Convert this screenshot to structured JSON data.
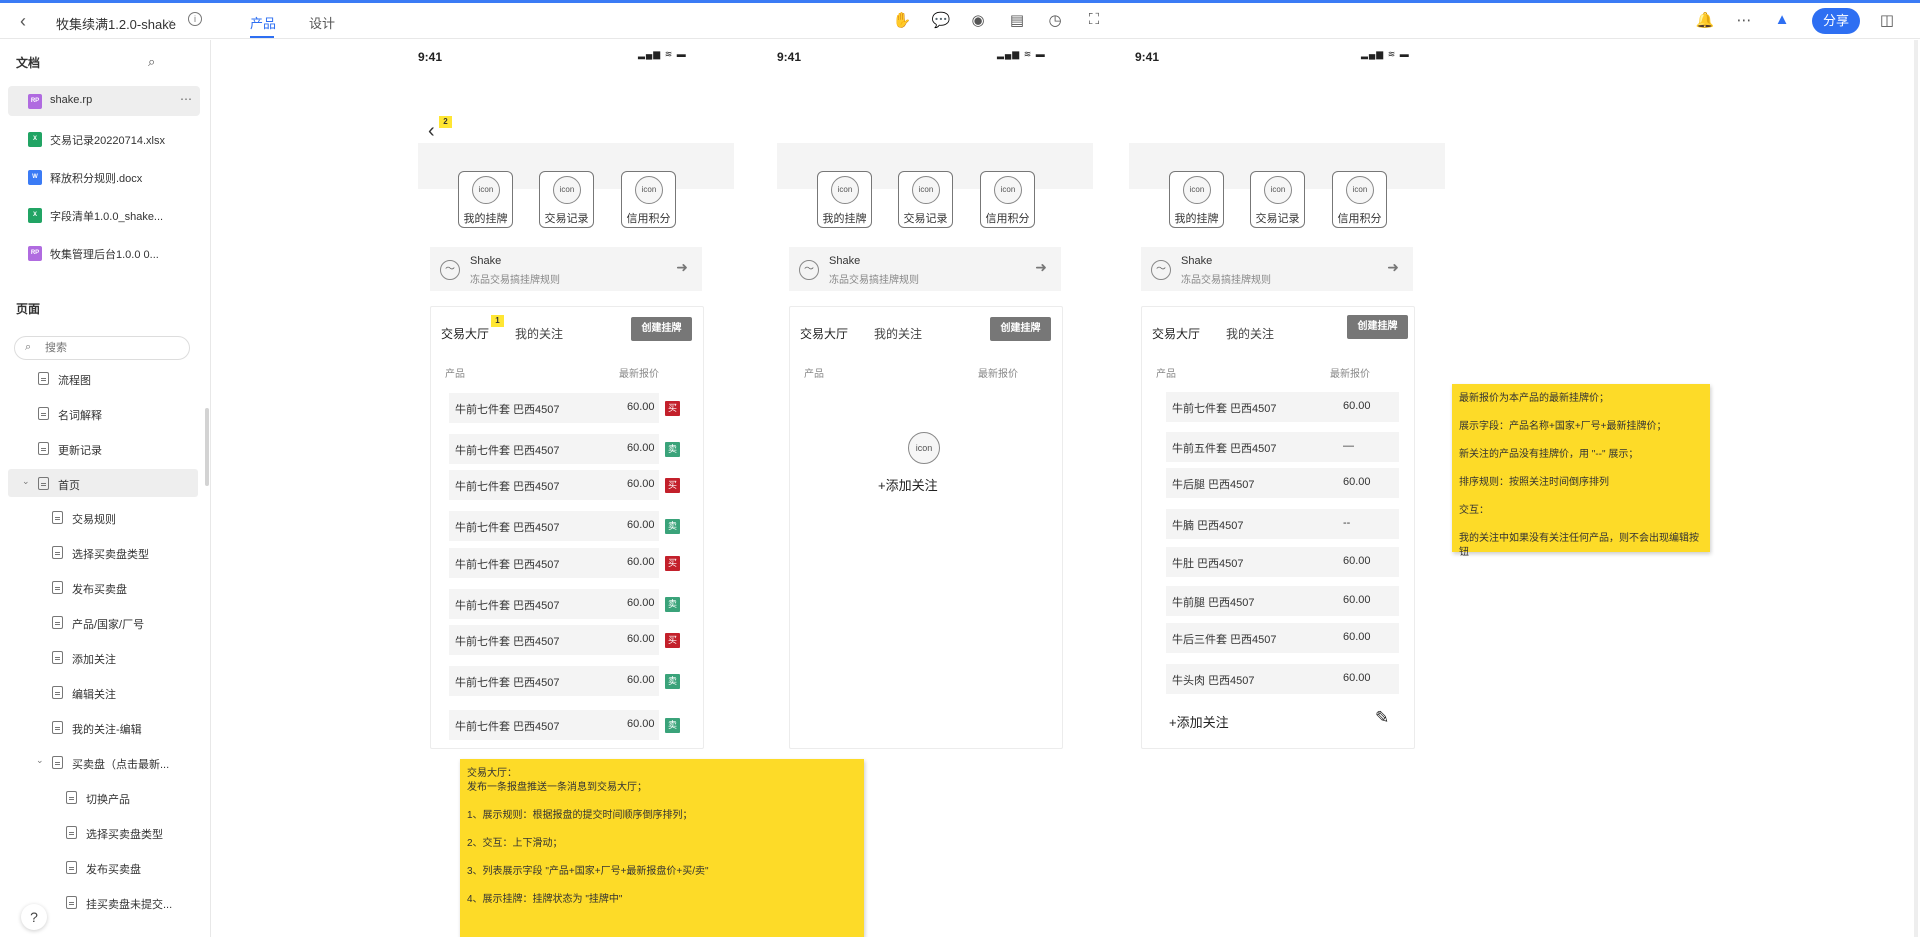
{
  "topbar": {
    "project": "牧集续满1.2.0-shake",
    "info_icon": "i",
    "tabs": [
      "产品",
      "设计"
    ],
    "share": "分享"
  },
  "sidebar": {
    "docs_title": "文档",
    "docs": [
      {
        "label": "shake.rp",
        "type": "RP",
        "color": "#b06be0"
      },
      {
        "label": "交易记录20220714.xlsx",
        "type": "X",
        "color": "#21a464"
      },
      {
        "label": "释放积分规则.docx",
        "type": "W",
        "color": "#3b7bf5"
      },
      {
        "label": "字段清单1.0.0_shake...",
        "type": "X",
        "color": "#21a464"
      },
      {
        "label": "牧集管理后台1.0.0 0...",
        "type": "RP",
        "color": "#b06be0"
      }
    ],
    "pages_title": "页面",
    "search_placeholder": "搜索",
    "pages": [
      {
        "label": "流程图"
      },
      {
        "label": "名词解释"
      },
      {
        "label": "更新记录"
      },
      {
        "label": "首页"
      },
      {
        "label": "交易规则"
      },
      {
        "label": "选择买卖盘类型"
      },
      {
        "label": "发布买卖盘"
      },
      {
        "label": "产品/国家/厂号"
      },
      {
        "label": "添加关注"
      },
      {
        "label": "编辑关注"
      },
      {
        "label": "我的关注-编辑"
      },
      {
        "label": "买卖盘（点击最新..."
      },
      {
        "label": "切换产品"
      },
      {
        "label": "选择买卖盘类型"
      },
      {
        "label": "发布买卖盘"
      },
      {
        "label": "挂买卖盘未提交..."
      }
    ],
    "help": "?"
  },
  "phones": [
    {
      "time": "9:41",
      "icons": [
        "我的挂牌",
        "交易记录",
        "信用积分"
      ],
      "icon_text": "icon",
      "shake_title": "Shake",
      "shake_sub": "冻品交易搞挂牌规则",
      "tab_hall": "交易大厅",
      "tab_follow": "我的关注",
      "create": "创建挂牌",
      "col_product": "产品",
      "col_price": "最新报价",
      "hall_badge": "1",
      "back_badge": "2",
      "rows": [
        {
          "name": "牛前七件套  巴西4507",
          "price": "60.00",
          "tag": "买",
          "kind": "buy"
        },
        {
          "name": "牛前七件套  巴西4507",
          "price": "60.00",
          "tag": "卖",
          "kind": "sell"
        },
        {
          "name": "牛前七件套  巴西4507",
          "price": "60.00",
          "tag": "买",
          "kind": "buy"
        },
        {
          "name": "牛前七件套  巴西4507",
          "price": "60.00",
          "tag": "卖",
          "kind": "sell"
        },
        {
          "name": "牛前七件套  巴西4507",
          "price": "60.00",
          "tag": "买",
          "kind": "buy"
        },
        {
          "name": "牛前七件套  巴西4507",
          "price": "60.00",
          "tag": "卖",
          "kind": "sell"
        },
        {
          "name": "牛前七件套  巴西4507",
          "price": "60.00",
          "tag": "买",
          "kind": "buy"
        },
        {
          "name": "牛前七件套  巴西4507",
          "price": "60.00",
          "tag": "卖",
          "kind": "sell"
        },
        {
          "name": "牛前七件套  巴西4507",
          "price": "60.00",
          "tag": "卖",
          "kind": "sell"
        }
      ]
    },
    {
      "time": "9:41",
      "icons": [
        "我的挂牌",
        "交易记录",
        "信用积分"
      ],
      "icon_text": "icon",
      "shake_title": "Shake",
      "shake_sub": "冻品交易搞挂牌规则",
      "tab_hall": "交易大厅",
      "tab_follow": "我的关注",
      "create": "创建挂牌",
      "col_product": "产品",
      "col_price": "最新报价",
      "empty_icon": "icon",
      "add_follow": "+添加关注"
    },
    {
      "time": "9:41",
      "icons": [
        "我的挂牌",
        "交易记录",
        "信用积分"
      ],
      "icon_text": "icon",
      "shake_title": "Shake",
      "shake_sub": "冻品交易搞挂牌规则",
      "tab_hall": "交易大厅",
      "tab_follow": "我的关注",
      "create": "创建挂牌",
      "col_product": "产品",
      "col_price": "最新报价",
      "rows": [
        {
          "name": "牛前七件套  巴西4507",
          "price": "60.00"
        },
        {
          "name": "牛前五件套  巴西4507",
          "price": "—"
        },
        {
          "name": "牛后腿  巴西4507",
          "price": "60.00"
        },
        {
          "name": "牛腩  巴西4507",
          "price": "--"
        },
        {
          "name": "牛肚  巴西4507",
          "price": "60.00"
        },
        {
          "name": "牛前腿  巴西4507",
          "price": "60.00"
        },
        {
          "name": "牛后三件套  巴西4507",
          "price": "60.00"
        },
        {
          "name": "牛头肉  巴西4507",
          "price": "60.00"
        }
      ],
      "add_follow": "+添加关注"
    }
  ],
  "notes": {
    "hall": [
      "交易大厅：",
      "发布一条报盘推送一条消息到交易大厅；",
      "1、展示规则：根据报盘的提交时间顺序倒序排列；",
      "2、交互：上下滑动；",
      "3、列表展示字段 \"产品+国家+厂号+最新报盘价+买/卖\"",
      "4、展示挂牌：挂牌状态为 \"挂牌中\""
    ],
    "follow": [
      "最新报价为本产品的最新挂牌价；",
      "展示字段：产品名称+国家+厂号+最新挂牌价；",
      "新关注的产品没有挂牌价，用 \"--\" 展示；",
      "排序规则：按照关注时间倒序排列",
      "交互：",
      "我的关注中如果没有关注任何产品，则不会出现编辑按钮"
    ]
  },
  "colors": {
    "accent": "#2e6ff2",
    "note": "#fddb28",
    "buy": "#c3202b",
    "sell": "#3aa37a"
  }
}
